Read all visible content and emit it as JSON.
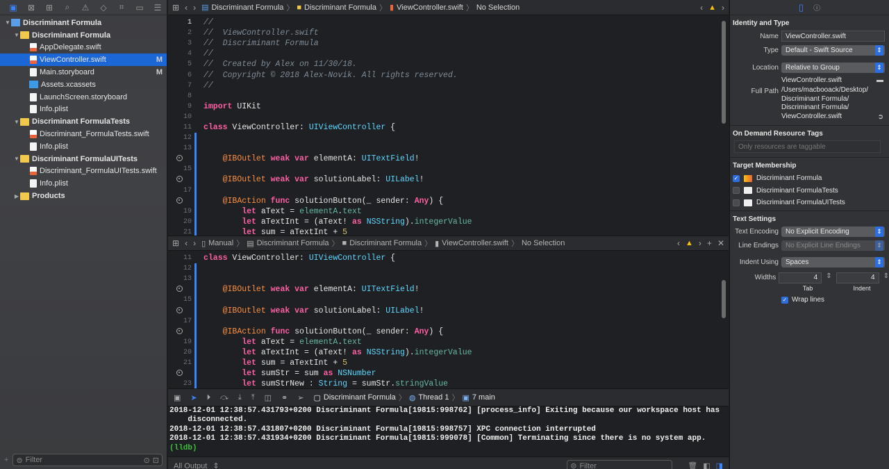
{
  "navigator": {
    "tree": [
      {
        "label": "Discriminant Formula",
        "kind": "project",
        "depth": 0,
        "disc": "▼",
        "badge": ""
      },
      {
        "label": "Discriminant Formula",
        "kind": "folder",
        "depth": 1,
        "disc": "▼",
        "badge": ""
      },
      {
        "label": "AppDelegate.swift",
        "kind": "swift",
        "depth": 2,
        "disc": "",
        "badge": ""
      },
      {
        "label": "ViewController.swift",
        "kind": "swift",
        "depth": 2,
        "disc": "",
        "badge": "M",
        "selected": true
      },
      {
        "label": "Main.storyboard",
        "kind": "file",
        "depth": 2,
        "disc": "",
        "badge": "M"
      },
      {
        "label": "Assets.xcassets",
        "kind": "assets",
        "depth": 2,
        "disc": "",
        "badge": ""
      },
      {
        "label": "LaunchScreen.storyboard",
        "kind": "file",
        "depth": 2,
        "disc": "",
        "badge": ""
      },
      {
        "label": "Info.plist",
        "kind": "file",
        "depth": 2,
        "disc": "",
        "badge": ""
      },
      {
        "label": "Discriminant FormulaTests",
        "kind": "folder",
        "depth": 1,
        "disc": "▼",
        "badge": ""
      },
      {
        "label": "Discriminant_FormulaTests.swift",
        "kind": "swift",
        "depth": 2,
        "disc": "",
        "badge": ""
      },
      {
        "label": "Info.plist",
        "kind": "file",
        "depth": 2,
        "disc": "",
        "badge": ""
      },
      {
        "label": "Discriminant FormulaUITests",
        "kind": "folder",
        "depth": 1,
        "disc": "▼",
        "badge": ""
      },
      {
        "label": "Discriminant_FormulaUITests.swift",
        "kind": "swift",
        "depth": 2,
        "disc": "",
        "badge": ""
      },
      {
        "label": "Info.plist",
        "kind": "file",
        "depth": 2,
        "disc": "",
        "badge": ""
      },
      {
        "label": "Products",
        "kind": "folder",
        "depth": 1,
        "disc": "▶",
        "badge": ""
      }
    ],
    "filter_placeholder": "Filter"
  },
  "editor_top": {
    "breadcrumbs": [
      "Discriminant Formula",
      "Discriminant Formula",
      "ViewController.swift",
      "No Selection"
    ],
    "lines": [
      {
        "n": "1",
        "chg": false,
        "bp": false,
        "segs": [
          [
            "cmt",
            "//"
          ]
        ]
      },
      {
        "n": "2",
        "chg": false,
        "bp": false,
        "segs": [
          [
            "cmt",
            "//  ViewController.swift"
          ]
        ]
      },
      {
        "n": "3",
        "chg": false,
        "bp": false,
        "segs": [
          [
            "cmt",
            "//  Discriminant Formula"
          ]
        ]
      },
      {
        "n": "4",
        "chg": false,
        "bp": false,
        "segs": [
          [
            "cmt",
            "//"
          ]
        ]
      },
      {
        "n": "5",
        "chg": false,
        "bp": false,
        "segs": [
          [
            "cmt",
            "//  Created by Alex on 11/30/18."
          ]
        ]
      },
      {
        "n": "6",
        "chg": false,
        "bp": false,
        "segs": [
          [
            "cmt",
            "//  Copyright © 2018 Alex-Novik. All rights reserved."
          ]
        ]
      },
      {
        "n": "7",
        "chg": false,
        "bp": false,
        "segs": [
          [
            "cmt",
            "//"
          ]
        ]
      },
      {
        "n": "8",
        "chg": false,
        "bp": false,
        "segs": []
      },
      {
        "n": "9",
        "chg": false,
        "bp": false,
        "segs": [
          [
            "kw",
            "import"
          ],
          [
            "",
            " UIKit"
          ]
        ]
      },
      {
        "n": "10",
        "chg": false,
        "bp": false,
        "segs": []
      },
      {
        "n": "11",
        "chg": false,
        "bp": false,
        "segs": [
          [
            "kw",
            "class"
          ],
          [
            "",
            " ViewController: "
          ],
          [
            "ty",
            "UIViewController"
          ],
          [
            "",
            " {"
          ]
        ]
      },
      {
        "n": "12",
        "chg": true,
        "bp": false,
        "segs": []
      },
      {
        "n": "13",
        "chg": true,
        "bp": false,
        "segs": []
      },
      {
        "n": "14",
        "chg": true,
        "bp": true,
        "segs": [
          [
            "",
            "    "
          ],
          [
            "at",
            "@IBOutlet"
          ],
          [
            "",
            " "
          ],
          [
            "kw",
            "weak"
          ],
          [
            "",
            " "
          ],
          [
            "kw",
            "var"
          ],
          [
            "",
            " elementA: "
          ],
          [
            "ty",
            "UITextField"
          ],
          [
            "",
            "!"
          ]
        ]
      },
      {
        "n": "15",
        "chg": true,
        "bp": false,
        "segs": []
      },
      {
        "n": "16",
        "chg": true,
        "bp": true,
        "segs": [
          [
            "",
            "    "
          ],
          [
            "at",
            "@IBOutlet"
          ],
          [
            "",
            " "
          ],
          [
            "kw",
            "weak"
          ],
          [
            "",
            " "
          ],
          [
            "kw",
            "var"
          ],
          [
            "",
            " solutionLabel: "
          ],
          [
            "ty",
            "UILabel"
          ],
          [
            "",
            "!"
          ]
        ]
      },
      {
        "n": "17",
        "chg": true,
        "bp": false,
        "segs": []
      },
      {
        "n": "18",
        "chg": true,
        "bp": true,
        "segs": [
          [
            "",
            "    "
          ],
          [
            "at",
            "@IBAction"
          ],
          [
            "",
            " "
          ],
          [
            "kw",
            "func"
          ],
          [
            "",
            " solutionButton(_ sender: "
          ],
          [
            "kw",
            "Any"
          ],
          [
            "",
            ") {"
          ]
        ]
      },
      {
        "n": "19",
        "chg": true,
        "bp": false,
        "segs": [
          [
            "",
            "        "
          ],
          [
            "kw",
            "let"
          ],
          [
            "",
            " aText = "
          ],
          [
            "fn",
            "elementA"
          ],
          [
            "",
            "."
          ],
          [
            "fn",
            "text"
          ]
        ]
      },
      {
        "n": "20",
        "chg": true,
        "bp": false,
        "segs": [
          [
            "",
            "        "
          ],
          [
            "kw",
            "let"
          ],
          [
            "",
            " aTextInt = (aText! "
          ],
          [
            "kw",
            "as"
          ],
          [
            "",
            " "
          ],
          [
            "ty",
            "NSString"
          ],
          [
            "",
            ")."
          ],
          [
            "fn",
            "integerValue"
          ]
        ]
      },
      {
        "n": "21",
        "chg": true,
        "bp": false,
        "segs": [
          [
            "",
            "        "
          ],
          [
            "kw",
            "let"
          ],
          [
            "",
            " sum = aTextInt + "
          ],
          [
            "nu",
            "5"
          ]
        ]
      }
    ]
  },
  "editor_bottom": {
    "breadcrumbs": [
      "Manual",
      "Discriminant Formula",
      "Discriminant Formula",
      "ViewController.swift",
      "No Selection"
    ],
    "lines": [
      {
        "n": "11",
        "chg": false,
        "bp": false,
        "segs": [
          [
            "kw",
            "class"
          ],
          [
            "",
            " ViewController: "
          ],
          [
            "ty",
            "UIViewController"
          ],
          [
            "",
            " {"
          ]
        ]
      },
      {
        "n": "12",
        "chg": true,
        "bp": false,
        "segs": []
      },
      {
        "n": "13",
        "chg": true,
        "bp": false,
        "segs": []
      },
      {
        "n": "14",
        "chg": true,
        "bp": true,
        "segs": [
          [
            "",
            "    "
          ],
          [
            "at",
            "@IBOutlet"
          ],
          [
            "",
            " "
          ],
          [
            "kw",
            "weak"
          ],
          [
            "",
            " "
          ],
          [
            "kw",
            "var"
          ],
          [
            "",
            " elementA: "
          ],
          [
            "ty",
            "UITextField"
          ],
          [
            "",
            "!"
          ]
        ]
      },
      {
        "n": "15",
        "chg": true,
        "bp": false,
        "segs": []
      },
      {
        "n": "16",
        "chg": true,
        "bp": true,
        "segs": [
          [
            "",
            "    "
          ],
          [
            "at",
            "@IBOutlet"
          ],
          [
            "",
            " "
          ],
          [
            "kw",
            "weak"
          ],
          [
            "",
            " "
          ],
          [
            "kw",
            "var"
          ],
          [
            "",
            " solutionLabel: "
          ],
          [
            "ty",
            "UILabel"
          ],
          [
            "",
            "!"
          ]
        ]
      },
      {
        "n": "17",
        "chg": true,
        "bp": false,
        "segs": []
      },
      {
        "n": "18",
        "chg": true,
        "bp": true,
        "segs": [
          [
            "",
            "    "
          ],
          [
            "at",
            "@IBAction"
          ],
          [
            "",
            " "
          ],
          [
            "kw",
            "func"
          ],
          [
            "",
            " solutionButton(_ sender: "
          ],
          [
            "kw",
            "Any"
          ],
          [
            "",
            ") {"
          ]
        ]
      },
      {
        "n": "19",
        "chg": true,
        "bp": false,
        "segs": [
          [
            "",
            "        "
          ],
          [
            "kw",
            "let"
          ],
          [
            "",
            " aText = "
          ],
          [
            "fn",
            "elementA"
          ],
          [
            "",
            "."
          ],
          [
            "fn",
            "text"
          ]
        ]
      },
      {
        "n": "20",
        "chg": true,
        "bp": false,
        "segs": [
          [
            "",
            "        "
          ],
          [
            "kw",
            "let"
          ],
          [
            "",
            " aTextInt = (aText! "
          ],
          [
            "kw",
            "as"
          ],
          [
            "",
            " "
          ],
          [
            "ty",
            "NSString"
          ],
          [
            "",
            ")."
          ],
          [
            "fn",
            "integerValue"
          ]
        ]
      },
      {
        "n": "21",
        "chg": true,
        "bp": false,
        "segs": [
          [
            "",
            "        "
          ],
          [
            "kw",
            "let"
          ],
          [
            "",
            " sum = aTextInt + "
          ],
          [
            "nu",
            "5"
          ]
        ]
      },
      {
        "n": "22",
        "chg": true,
        "bp": true,
        "segs": [
          [
            "",
            "        "
          ],
          [
            "kw",
            "let"
          ],
          [
            "",
            " sumStr = sum "
          ],
          [
            "kw",
            "as"
          ],
          [
            "",
            " "
          ],
          [
            "ty",
            "NSNumber"
          ]
        ]
      },
      {
        "n": "23",
        "chg": true,
        "bp": false,
        "segs": [
          [
            "",
            "        "
          ],
          [
            "kw",
            "let"
          ],
          [
            "",
            " sumStrNew : "
          ],
          [
            "ty",
            "String"
          ],
          [
            "",
            " = sumStr."
          ],
          [
            "fn",
            "stringValue"
          ]
        ]
      }
    ]
  },
  "debug_bar": {
    "target": "Discriminant Formula",
    "thread": "Thread 1",
    "frame": "7 main"
  },
  "console": {
    "lines": [
      "2018-12-01 12:38:57.431793+0200 Discriminant Formula[19815:998762] [process_info] Exiting because our workspace host has",
      "    disconnected.",
      "2018-12-01 12:38:57.431807+0200 Discriminant Formula[19815:998757] XPC connection interrupted",
      "2018-12-01 12:38:57.431934+0200 Discriminant Formula[19815:999078] [Common] Terminating since there is no system app."
    ],
    "prompt": "(lldb)",
    "output_selector": "All Output",
    "filter_placeholder": "Filter"
  },
  "inspector": {
    "identity_title": "Identity and Type",
    "name_label": "Name",
    "name_value": "ViewController.swift",
    "type_label": "Type",
    "type_value": "Default - Swift Source",
    "location_label": "Location",
    "location_value": "Relative to Group",
    "location_file": "ViewController.swift",
    "fullpath_label": "Full Path",
    "fullpath_value": "/Users/macbooack/Desktop/\nDiscriminant Formula/\nDiscriminant Formula/\nViewController.swift",
    "odr_title": "On Demand Resource Tags",
    "odr_placeholder": "Only resources are taggable",
    "membership_title": "Target Membership",
    "targets": [
      {
        "label": "Discriminant Formula",
        "checked": true
      },
      {
        "label": "Discriminant FormulaTests",
        "checked": false
      },
      {
        "label": "Discriminant FormulaUITests",
        "checked": false
      }
    ],
    "text_settings_title": "Text Settings",
    "encoding_label": "Text Encoding",
    "encoding_value": "No Explicit Encoding",
    "endings_label": "Line Endings",
    "endings_value": "No Explicit Line Endings",
    "indent_label": "Indent Using",
    "indent_value": "Spaces",
    "widths_label": "Widths",
    "tab_value": "4",
    "indent_width_value": "4",
    "tab_caption": "Tab",
    "indent_caption": "Indent",
    "wrap_label": "Wrap lines"
  }
}
